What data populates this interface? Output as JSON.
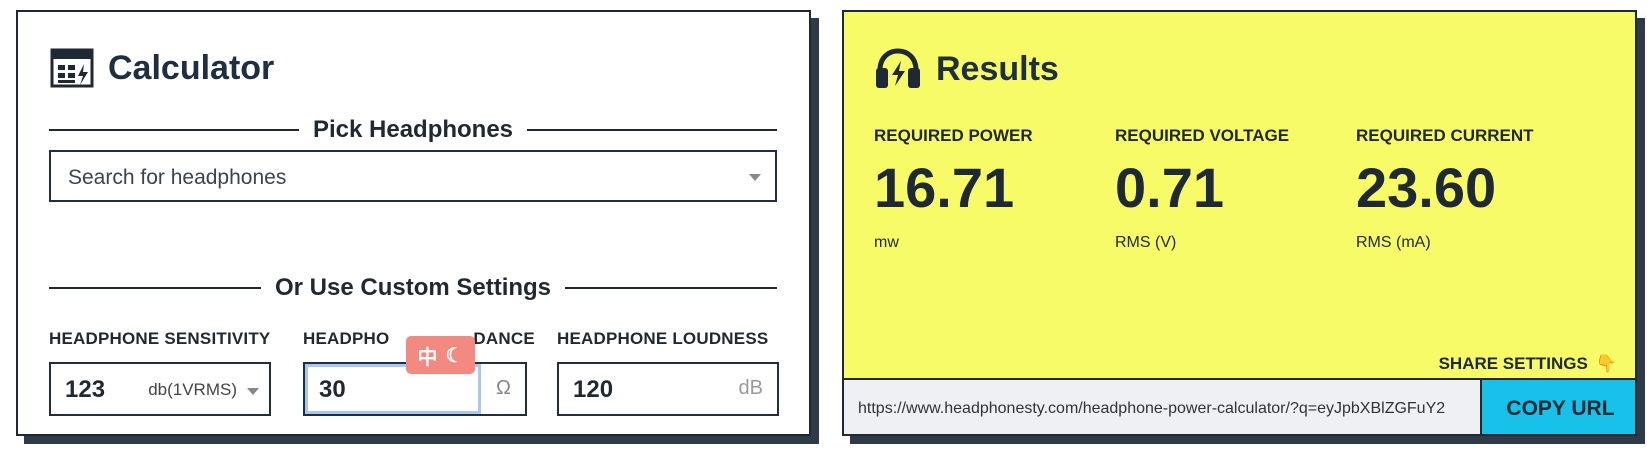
{
  "calculator": {
    "title": "Calculator",
    "pick_heading": "Pick Headphones",
    "search_placeholder": "Search for headphones",
    "custom_heading": "Or Use Custom Settings",
    "fields": [
      {
        "label": "HEADPHONE SENSITIVITY",
        "value": "123",
        "unit": "db(1VRMS)"
      },
      {
        "label": "HEADPHONE IMPEDANCE",
        "label_visible": "HEADPHO",
        "label_visible_end": "DANCE",
        "value": "30",
        "unit": "Ω"
      },
      {
        "label": "HEADPHONE LOUDNESS",
        "value": "120",
        "unit": "dB"
      }
    ]
  },
  "overlay_badge": {
    "char": "中",
    "moon": "☾"
  },
  "results": {
    "title": "Results",
    "metrics": [
      {
        "label": "REQUIRED POWER",
        "value": "16.71",
        "unit": "mw"
      },
      {
        "label": "REQUIRED VOLTAGE",
        "value": "0.71",
        "unit": "RMS (V)"
      },
      {
        "label": "REQUIRED CURRENT",
        "value": "23.60",
        "unit": "RMS (mA)"
      }
    ],
    "share_label": "SHARE SETTINGS",
    "share_emoji": "👇",
    "url": "https://www.headphonesty.com/headphone-power-calculator/?q=eyJpbXBlZGFuY2",
    "copy_label": "COPY URL"
  },
  "colors": {
    "results_bg": "#f8fb68",
    "copy_bg": "#17c1ea",
    "badge_bg": "#f28a82"
  }
}
